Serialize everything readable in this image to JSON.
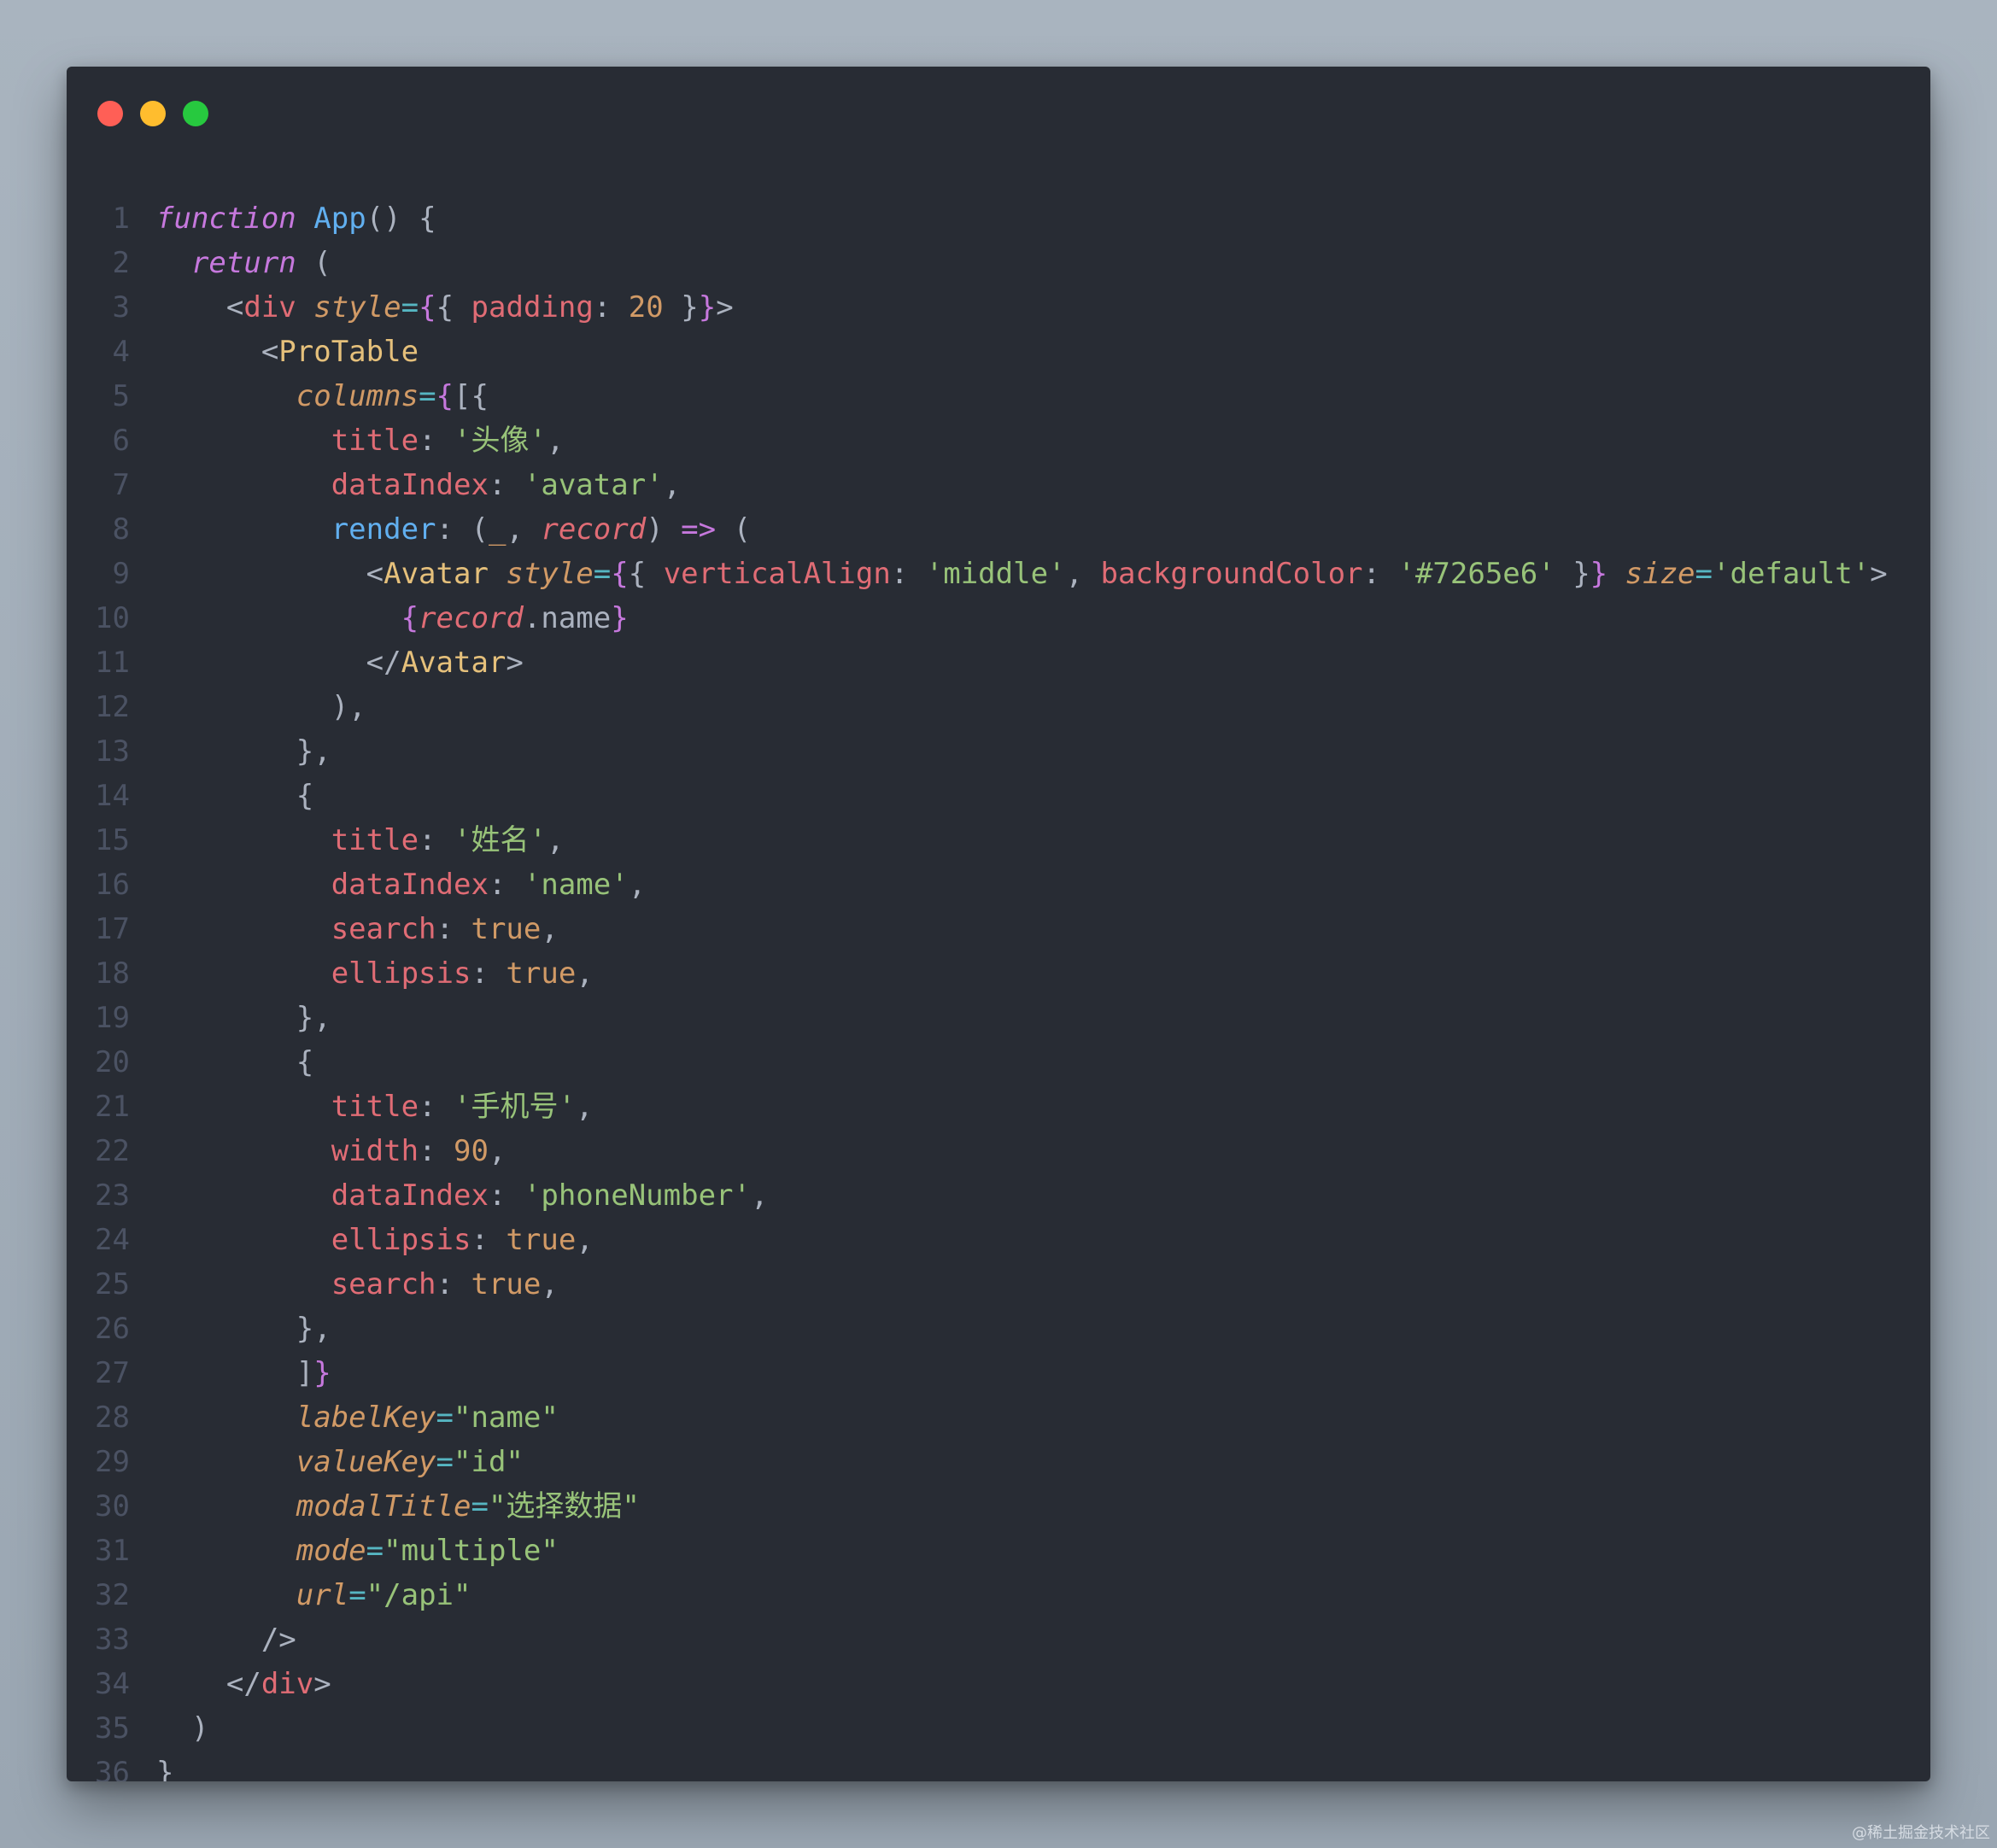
{
  "window": {
    "controls": [
      {
        "name": "close",
        "color": "#ff5f56"
      },
      {
        "name": "minimize",
        "color": "#ffbd2e"
      },
      {
        "name": "maximize",
        "color": "#27c93f"
      }
    ]
  },
  "code": {
    "language": "jsx",
    "lines": [
      [
        {
          "t": "function",
          "c": "kw"
        },
        {
          "t": " ",
          "c": "pl"
        },
        {
          "t": "App",
          "c": "fn"
        },
        {
          "t": "() {",
          "c": "pl"
        }
      ],
      [
        {
          "t": "  ",
          "c": "pl"
        },
        {
          "t": "return",
          "c": "kw"
        },
        {
          "t": " (",
          "c": "pl"
        }
      ],
      [
        {
          "t": "    <",
          "c": "pl"
        },
        {
          "t": "div",
          "c": "tag"
        },
        {
          "t": " ",
          "c": "pl"
        },
        {
          "t": "style",
          "c": "attr"
        },
        {
          "t": "=",
          "c": "op"
        },
        {
          "t": "{",
          "c": "br"
        },
        {
          "t": "{ ",
          "c": "pl"
        },
        {
          "t": "padding",
          "c": "prop"
        },
        {
          "t": ": ",
          "c": "pl"
        },
        {
          "t": "20",
          "c": "num"
        },
        {
          "t": " }",
          "c": "pl"
        },
        {
          "t": "}",
          "c": "br"
        },
        {
          "t": ">",
          "c": "pl"
        }
      ],
      [
        {
          "t": "      <",
          "c": "pl"
        },
        {
          "t": "ProTable",
          "c": "comp"
        }
      ],
      [
        {
          "t": "        ",
          "c": "pl"
        },
        {
          "t": "columns",
          "c": "attr"
        },
        {
          "t": "=",
          "c": "op"
        },
        {
          "t": "{",
          "c": "br"
        },
        {
          "t": "[{",
          "c": "pl"
        }
      ],
      [
        {
          "t": "          ",
          "c": "pl"
        },
        {
          "t": "title",
          "c": "prop"
        },
        {
          "t": ": ",
          "c": "pl"
        },
        {
          "t": "'头像'",
          "c": "str"
        },
        {
          "t": ",",
          "c": "pl"
        }
      ],
      [
        {
          "t": "          ",
          "c": "pl"
        },
        {
          "t": "dataIndex",
          "c": "prop"
        },
        {
          "t": ": ",
          "c": "pl"
        },
        {
          "t": "'avatar'",
          "c": "str"
        },
        {
          "t": ",",
          "c": "pl"
        }
      ],
      [
        {
          "t": "          ",
          "c": "pl"
        },
        {
          "t": "render",
          "c": "fn"
        },
        {
          "t": ": (",
          "c": "pl"
        },
        {
          "t": "_",
          "c": "num"
        },
        {
          "t": ", ",
          "c": "pl"
        },
        {
          "t": "record",
          "c": "prop it"
        },
        {
          "t": ") ",
          "c": "pl"
        },
        {
          "t": "=>",
          "c": "kw"
        },
        {
          "t": " (",
          "c": "pl"
        }
      ],
      [
        {
          "t": "            <",
          "c": "pl"
        },
        {
          "t": "Avatar",
          "c": "comp"
        },
        {
          "t": " ",
          "c": "pl"
        },
        {
          "t": "style",
          "c": "attr"
        },
        {
          "t": "=",
          "c": "op"
        },
        {
          "t": "{",
          "c": "br"
        },
        {
          "t": "{ ",
          "c": "pl"
        },
        {
          "t": "verticalAlign",
          "c": "prop"
        },
        {
          "t": ": ",
          "c": "pl"
        },
        {
          "t": "'middle'",
          "c": "str"
        },
        {
          "t": ", ",
          "c": "pl"
        },
        {
          "t": "backgroundColor",
          "c": "prop"
        },
        {
          "t": ": ",
          "c": "pl"
        },
        {
          "t": "'#7265e6'",
          "c": "str"
        },
        {
          "t": " }",
          "c": "pl"
        },
        {
          "t": "}",
          "c": "br"
        },
        {
          "t": " ",
          "c": "pl"
        },
        {
          "t": "size",
          "c": "attr"
        },
        {
          "t": "=",
          "c": "op"
        },
        {
          "t": "'default'",
          "c": "str"
        },
        {
          "t": ">",
          "c": "pl"
        }
      ],
      [
        {
          "t": "              ",
          "c": "pl"
        },
        {
          "t": "{",
          "c": "br"
        },
        {
          "t": "record",
          "c": "prop it"
        },
        {
          "t": ".name",
          "c": "pl"
        },
        {
          "t": "}",
          "c": "br"
        }
      ],
      [
        {
          "t": "            </",
          "c": "pl"
        },
        {
          "t": "Avatar",
          "c": "comp"
        },
        {
          "t": ">",
          "c": "pl"
        }
      ],
      [
        {
          "t": "          ),",
          "c": "pl"
        }
      ],
      [
        {
          "t": "        },",
          "c": "pl"
        }
      ],
      [
        {
          "t": "        {",
          "c": "pl"
        }
      ],
      [
        {
          "t": "          ",
          "c": "pl"
        },
        {
          "t": "title",
          "c": "prop"
        },
        {
          "t": ": ",
          "c": "pl"
        },
        {
          "t": "'姓名'",
          "c": "str"
        },
        {
          "t": ",",
          "c": "pl"
        }
      ],
      [
        {
          "t": "          ",
          "c": "pl"
        },
        {
          "t": "dataIndex",
          "c": "prop"
        },
        {
          "t": ": ",
          "c": "pl"
        },
        {
          "t": "'name'",
          "c": "str"
        },
        {
          "t": ",",
          "c": "pl"
        }
      ],
      [
        {
          "t": "          ",
          "c": "pl"
        },
        {
          "t": "search",
          "c": "prop"
        },
        {
          "t": ": ",
          "c": "pl"
        },
        {
          "t": "true",
          "c": "num"
        },
        {
          "t": ",",
          "c": "pl"
        }
      ],
      [
        {
          "t": "          ",
          "c": "pl"
        },
        {
          "t": "ellipsis",
          "c": "prop"
        },
        {
          "t": ": ",
          "c": "pl"
        },
        {
          "t": "true",
          "c": "num"
        },
        {
          "t": ",",
          "c": "pl"
        }
      ],
      [
        {
          "t": "        },",
          "c": "pl"
        }
      ],
      [
        {
          "t": "        {",
          "c": "pl"
        }
      ],
      [
        {
          "t": "          ",
          "c": "pl"
        },
        {
          "t": "title",
          "c": "prop"
        },
        {
          "t": ": ",
          "c": "pl"
        },
        {
          "t": "'手机号'",
          "c": "str"
        },
        {
          "t": ",",
          "c": "pl"
        }
      ],
      [
        {
          "t": "          ",
          "c": "pl"
        },
        {
          "t": "width",
          "c": "prop"
        },
        {
          "t": ": ",
          "c": "pl"
        },
        {
          "t": "90",
          "c": "num"
        },
        {
          "t": ",",
          "c": "pl"
        }
      ],
      [
        {
          "t": "          ",
          "c": "pl"
        },
        {
          "t": "dataIndex",
          "c": "prop"
        },
        {
          "t": ": ",
          "c": "pl"
        },
        {
          "t": "'phoneNumber'",
          "c": "str"
        },
        {
          "t": ",",
          "c": "pl"
        }
      ],
      [
        {
          "t": "          ",
          "c": "pl"
        },
        {
          "t": "ellipsis",
          "c": "prop"
        },
        {
          "t": ": ",
          "c": "pl"
        },
        {
          "t": "true",
          "c": "num"
        },
        {
          "t": ",",
          "c": "pl"
        }
      ],
      [
        {
          "t": "          ",
          "c": "pl"
        },
        {
          "t": "search",
          "c": "prop"
        },
        {
          "t": ": ",
          "c": "pl"
        },
        {
          "t": "true",
          "c": "num"
        },
        {
          "t": ",",
          "c": "pl"
        }
      ],
      [
        {
          "t": "        },",
          "c": "pl"
        }
      ],
      [
        {
          "t": "        ]",
          "c": "pl"
        },
        {
          "t": "}",
          "c": "br"
        }
      ],
      [
        {
          "t": "        ",
          "c": "pl"
        },
        {
          "t": "labelKey",
          "c": "attr"
        },
        {
          "t": "=",
          "c": "op"
        },
        {
          "t": "\"name\"",
          "c": "str"
        }
      ],
      [
        {
          "t": "        ",
          "c": "pl"
        },
        {
          "t": "valueKey",
          "c": "attr"
        },
        {
          "t": "=",
          "c": "op"
        },
        {
          "t": "\"id\"",
          "c": "str"
        }
      ],
      [
        {
          "t": "        ",
          "c": "pl"
        },
        {
          "t": "modalTitle",
          "c": "attr"
        },
        {
          "t": "=",
          "c": "op"
        },
        {
          "t": "\"选择数据\"",
          "c": "str"
        }
      ],
      [
        {
          "t": "        ",
          "c": "pl"
        },
        {
          "t": "mode",
          "c": "attr"
        },
        {
          "t": "=",
          "c": "op"
        },
        {
          "t": "\"multiple\"",
          "c": "str"
        }
      ],
      [
        {
          "t": "        ",
          "c": "pl"
        },
        {
          "t": "url",
          "c": "attr"
        },
        {
          "t": "=",
          "c": "op"
        },
        {
          "t": "\"/api\"",
          "c": "str"
        }
      ],
      [
        {
          "t": "      />",
          "c": "pl"
        }
      ],
      [
        {
          "t": "    </",
          "c": "pl"
        },
        {
          "t": "div",
          "c": "tag"
        },
        {
          "t": ">",
          "c": "pl"
        }
      ],
      [
        {
          "t": "  )",
          "c": "pl"
        }
      ],
      [
        {
          "t": "}",
          "c": "pl"
        }
      ]
    ]
  },
  "watermark": "@稀土掘金技术社区"
}
